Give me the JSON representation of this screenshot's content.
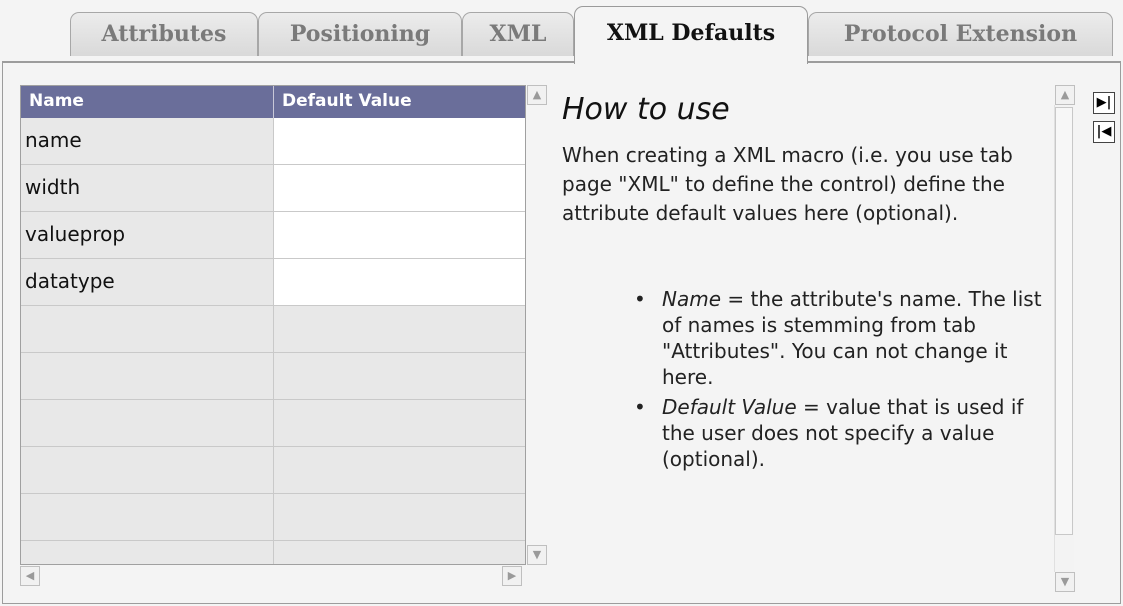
{
  "tabs": [
    {
      "label": "Attributes",
      "active": false
    },
    {
      "label": "Positioning",
      "active": false
    },
    {
      "label": "XML",
      "active": false
    },
    {
      "label": "XML Defaults",
      "active": true
    },
    {
      "label": "Protocol Extension",
      "active": false
    }
  ],
  "grid": {
    "columns": [
      "Name",
      "Default Value"
    ],
    "rows": [
      {
        "name": "name",
        "default_value": ""
      },
      {
        "name": "width",
        "default_value": ""
      },
      {
        "name": "valueprop",
        "default_value": ""
      },
      {
        "name": "datatype",
        "default_value": ""
      }
    ]
  },
  "help": {
    "title": "How to use",
    "intro": "When creating a XML macro (i.e. you use tab page \"XML\" to define the control) define the attribute default values here (optional).",
    "items": [
      {
        "term": "Name",
        "text": " = the attribute's name. The list of names is stemming from tab \"Attributes\". You can not change it here."
      },
      {
        "term": "Default Value",
        "text": " = value that is used if the user does not specify a value (optional)."
      }
    ]
  },
  "colors": {
    "header_bg": "#6a6e9a",
    "panel_bg": "#f4f4f4"
  },
  "icons": {
    "scroll_up": "▲",
    "scroll_down": "▼",
    "scroll_left": "◀",
    "scroll_right": "▶",
    "nav_last": "▶|",
    "nav_first": "|◀"
  }
}
